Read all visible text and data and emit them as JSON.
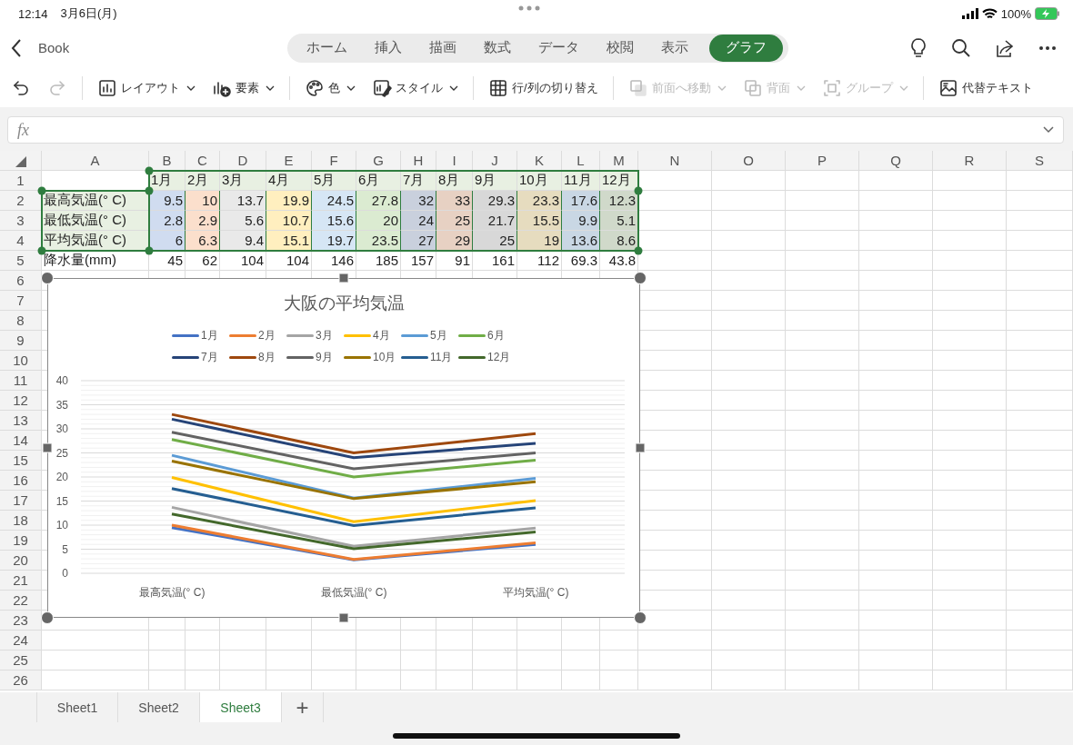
{
  "status_bar": {
    "time": "12:14",
    "date": "3月6日(月)",
    "battery": "100%"
  },
  "header": {
    "back_label": "Book",
    "tabs": [
      {
        "label": "ホーム",
        "selected": false
      },
      {
        "label": "挿入",
        "selected": false
      },
      {
        "label": "描画",
        "selected": false
      },
      {
        "label": "数式",
        "selected": false
      },
      {
        "label": "データ",
        "selected": false
      },
      {
        "label": "校閲",
        "selected": false
      },
      {
        "label": "表示",
        "selected": false
      },
      {
        "label": "グラフ",
        "selected": true
      }
    ]
  },
  "ribbon": {
    "items": [
      {
        "kind": "undo",
        "disabled": false
      },
      {
        "kind": "redo",
        "disabled": true
      },
      {
        "kind": "divider"
      },
      {
        "kind": "layout",
        "label": "レイアウト",
        "dropdown": true,
        "disabled": false
      },
      {
        "kind": "elements",
        "label": "要素",
        "dropdown": true,
        "disabled": false
      },
      {
        "kind": "divider"
      },
      {
        "kind": "palette",
        "label": "色",
        "dropdown": true,
        "disabled": false
      },
      {
        "kind": "style",
        "label": "スタイル",
        "dropdown": true,
        "disabled": false
      },
      {
        "kind": "divider"
      },
      {
        "kind": "switch",
        "label": "行/列の切り替え",
        "dropdown": false,
        "disabled": false
      },
      {
        "kind": "divider"
      },
      {
        "kind": "front",
        "label": "前面へ移動",
        "dropdown": true,
        "disabled": true
      },
      {
        "kind": "back",
        "label": "背面",
        "dropdown": true,
        "disabled": true
      },
      {
        "kind": "group",
        "label": "グループ",
        "dropdown": true,
        "disabled": true
      },
      {
        "kind": "divider"
      },
      {
        "kind": "alt",
        "label": "代替テキスト",
        "dropdown": false,
        "disabled": false
      }
    ]
  },
  "formula_bar": {
    "label": "fx"
  },
  "sheet": {
    "columns": [
      "A",
      "B",
      "C",
      "D",
      "E",
      "F",
      "G",
      "H",
      "I",
      "J",
      "K",
      "L",
      "M",
      "N",
      "O",
      "P",
      "Q",
      "R",
      "S"
    ],
    "rows": [
      {
        "number": "1",
        "highlighted": true,
        "values": [
          "1月",
          "2月",
          "3月",
          "4月",
          "5月",
          "6月",
          "7月",
          "8月",
          "9月",
          "10月",
          "11月",
          "12月"
        ]
      },
      {
        "number": "2",
        "highlighted": true,
        "label": "最高気温(° C)",
        "values": [
          "9.5",
          "10",
          "13.7",
          "19.9",
          "24.5",
          "27.8",
          "32",
          "33",
          "29.3",
          "23.3",
          "17.6",
          "12.3"
        ]
      },
      {
        "number": "3",
        "highlighted": true,
        "label": "最低気温(° C)",
        "values": [
          "2.8",
          "2.9",
          "5.6",
          "10.7",
          "15.6",
          "20",
          "24",
          "25",
          "21.7",
          "15.5",
          "9.9",
          "5.1"
        ]
      },
      {
        "number": "4",
        "highlighted": true,
        "label": "平均気温(° C)",
        "values": [
          "6",
          "6.3",
          "9.4",
          "15.1",
          "19.7",
          "23.5",
          "27",
          "29",
          "25",
          "19",
          "13.6",
          "8.6"
        ]
      },
      {
        "number": "5",
        "highlighted": false,
        "label": "降水量(mm)",
        "values": [
          "45",
          "62",
          "104",
          "104",
          "146",
          "185",
          "157",
          "91",
          "161",
          "112",
          "69.3",
          "43.8"
        ]
      },
      {
        "number": "6",
        "highlighted": false
      },
      {
        "number": "7",
        "highlighted": false
      },
      {
        "number": "8",
        "highlighted": false
      },
      {
        "number": "9",
        "highlighted": false
      },
      {
        "number": "10",
        "highlighted": false
      },
      {
        "number": "11",
        "highlighted": false
      },
      {
        "number": "12",
        "highlighted": false
      },
      {
        "number": "13",
        "highlighted": false
      },
      {
        "number": "14",
        "highlighted": false
      },
      {
        "number": "15",
        "highlighted": false
      },
      {
        "number": "16",
        "highlighted": false
      },
      {
        "number": "17",
        "highlighted": false
      },
      {
        "number": "18",
        "highlighted": false
      },
      {
        "number": "19",
        "highlighted": false
      },
      {
        "number": "20",
        "highlighted": false
      },
      {
        "number": "21",
        "highlighted": false
      },
      {
        "number": "22",
        "highlighted": false
      },
      {
        "number": "23",
        "highlighted": false
      },
      {
        "number": "24",
        "highlighted": false
      },
      {
        "number": "25",
        "highlighted": false
      },
      {
        "number": "26",
        "highlighted": false
      }
    ],
    "chart_data": {
      "type": "line",
      "title": "大阪の平均気温",
      "categories": [
        "最高気温(° C)",
        "最低気温(° C)",
        "平均気温(° C)"
      ],
      "ylim": [
        0,
        40
      ],
      "grid": true,
      "yticks": [
        0,
        5,
        10,
        15,
        20,
        25,
        30,
        35,
        40
      ],
      "series": [
        {
          "name": "1月",
          "color": "#4472c4",
          "values": [
            9.5,
            2.8,
            6
          ]
        },
        {
          "name": "2月",
          "color": "#ed7d31",
          "values": [
            10,
            2.9,
            6.3
          ]
        },
        {
          "name": "3月",
          "color": "#a5a5a5",
          "values": [
            13.7,
            5.6,
            9.4
          ]
        },
        {
          "name": "4月",
          "color": "#ffc000",
          "values": [
            19.9,
            10.7,
            15.1
          ]
        },
        {
          "name": "5月",
          "color": "#5b9bd5",
          "values": [
            24.5,
            15.6,
            19.7
          ]
        },
        {
          "name": "6月",
          "color": "#70ad47",
          "values": [
            27.8,
            20,
            23.5
          ]
        },
        {
          "name": "7月",
          "color": "#264478",
          "values": [
            32,
            24,
            27
          ]
        },
        {
          "name": "8月",
          "color": "#9e480e",
          "values": [
            33,
            25,
            29
          ]
        },
        {
          "name": "9月",
          "color": "#636363",
          "values": [
            29.3,
            21.7,
            25
          ]
        },
        {
          "name": "10月",
          "color": "#997300",
          "values": [
            23.3,
            15.5,
            19
          ]
        },
        {
          "name": "11月",
          "color": "#255e91",
          "values": [
            17.6,
            9.9,
            13.6
          ]
        },
        {
          "name": "12月",
          "color": "#43682b",
          "values": [
            12.3,
            5.1,
            8.6
          ]
        }
      ]
    }
  },
  "sheet_tabs": {
    "tabs": [
      {
        "label": "Sheet1",
        "selected": false
      },
      {
        "label": "Sheet2",
        "selected": false
      },
      {
        "label": "Sheet3",
        "selected": true
      }
    ],
    "add_label": "+"
  }
}
